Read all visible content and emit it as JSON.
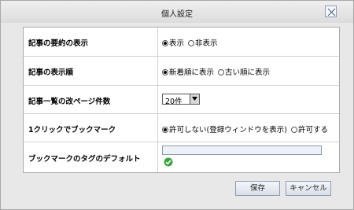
{
  "dialog": {
    "title": "個人設定"
  },
  "settings": {
    "summary": {
      "label": "記事の要約の表示",
      "options": [
        "表示",
        "非表示"
      ]
    },
    "order": {
      "label": "記事の表示順",
      "options": [
        "新着順に表示",
        "古い順に表示"
      ]
    },
    "page_size": {
      "label": "記事一覧の改ページ件数",
      "value": "20件"
    },
    "one_click": {
      "label": "1クリックでブックマーク",
      "options": [
        "許可しない(登録ウィンドウを表示)",
        "許可する"
      ]
    },
    "default_tag": {
      "label": "ブックマークのタグのデフォルト",
      "value": ""
    }
  },
  "buttons": {
    "save": "保存",
    "cancel": "キャンセル"
  },
  "colors": {
    "ok_icon": "#3aa53a"
  }
}
